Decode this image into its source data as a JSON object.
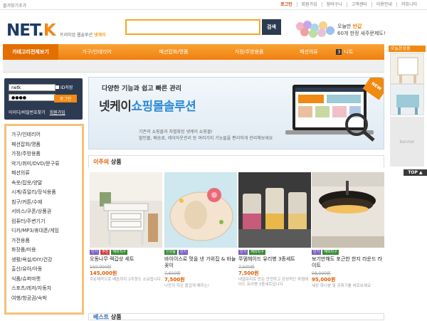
{
  "topbar": {
    "favorite": "즐겨찾기추가",
    "nav": [
      "로그인",
      "회원가입",
      "장바구니",
      "고객센터",
      "이용안내",
      "커뮤니티"
    ]
  },
  "header": {
    "logo_main": "NET.",
    "logo_accent": "K",
    "slogan_prefix": "프리미엄 웹솔루션",
    "slogan_brand": "넷케이",
    "search_placeholder": "",
    "search_button": "검색",
    "promo_line1_prefix": "오늘만",
    "promo_line1_accent": "반값",
    "promo_line2": "60개 한정 새주문제도!"
  },
  "gnb": {
    "category_all": "카테고리전체보기",
    "items": [
      "가구/인테리어",
      "패션잡화/명품",
      "가정/주방용품",
      "패션의류"
    ],
    "last_num": "3",
    "last_label": "니트"
  },
  "right_panel": {
    "title": "오늘본상품",
    "banner": "banner",
    "top": "TOP"
  },
  "login": {
    "id_value": "netk",
    "pw_value": "●●●●",
    "id_save": "ID저장",
    "login_button": "로그인",
    "find": "아이디/비밀번호찾기",
    "join": "회원가입"
  },
  "categories": [
    "가구/인테리어",
    "패션잡화/명품",
    "가정/주방용품",
    "악기/취미/DVD/문구류",
    "패션의류",
    "속옷/잡옷/양말",
    "시계/쥬얼리/장식용품",
    "침구/커튼/수예",
    "서비스/쿠폰/상품권",
    "컴퓨터/주변기기",
    "디카/MP3/휴대폰/게임",
    "가전용품",
    "화장품/미용",
    "생활/욕실/DIY/건강",
    "출산/유아/아동",
    "식품/슈퍼마켓",
    "스포츠/레저/자동차",
    "여행/항공권/숙박"
  ],
  "hero": {
    "line1": "다양한 기능과 쉽고 빠른 관리",
    "brand": "넷케이",
    "accent": "쇼핑몰솔루션",
    "desc1": "기존의 쇼핑몰과 차별화된 넷케이 쇼핑몰!",
    "desc2": "할인몰, 배송료, 레이아웃관리 등 여러가지 기능들을 편리하게 관리해보세요",
    "badge": "NEW"
  },
  "section": {
    "weekly_prefix": "이주의",
    "weekly_suffix": "상품",
    "best_prefix": "베스트",
    "best_suffix": "상품"
  },
  "products": [
    {
      "badges": [
        "인기",
        "추천",
        "해외직구"
      ],
      "name": "오동나무 렉갑상 세트",
      "orig": "150,000원",
      "price": "145,000원",
      "note": "주문제작으로 배송까지 2주정도 소요됩니다."
    },
    {
      "badges": [
        "신상품",
        "인기"
      ],
      "name": "바이이스로 멋을 낸 가위집 & 바늘꽂이",
      "orig": "7,600원",
      "price": "7,500원",
      "note": "나만의 작은 즐겁게 해주는!"
    },
    {
      "badges": [
        "인기",
        "해외직구"
      ],
      "name": "쭈뎀헤이드 유리병 3종세트",
      "orig": "7,500원",
      "price": "7,500원",
      "note": "내열유리로 만든 안전하고 감성적인 쭈뎀헤이드 유리병 3종세트입니다"
    },
    {
      "badges": [
        "인기",
        "해외직구"
      ],
      "name": "보기만해도 포근한 한지 라운드 라이트",
      "orig": "98,000원",
      "price": "95,000원",
      "note": "세상 하나뿐 및 공휘기를 바로보세요"
    }
  ],
  "colors": {
    "accent": "#f08a12",
    "navy": "#2d3b52",
    "price": "#e05a00"
  }
}
